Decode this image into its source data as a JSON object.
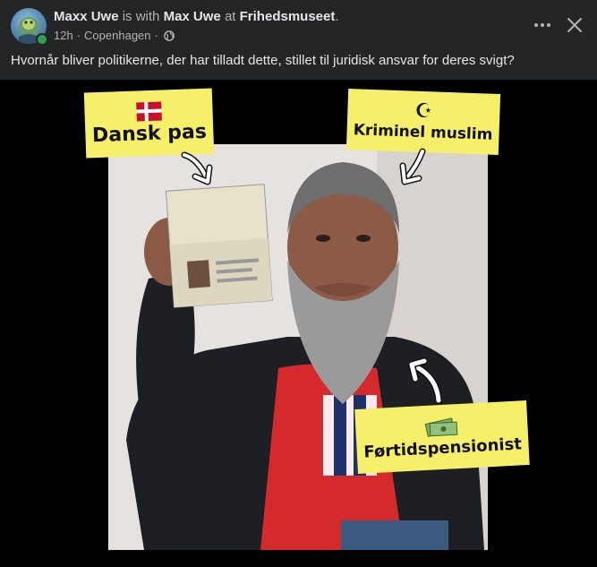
{
  "header": {
    "author": "Maxx Uwe",
    "with_text": "is with",
    "tagged": "Max Uwe",
    "at_text": "at",
    "place": "Frihedsmuseet",
    "period": ".",
    "time": "12h",
    "location": "Copenhagen",
    "separator": "·",
    "audience_icon": "globe-icon"
  },
  "actions": {
    "more_icon": "more-icon",
    "close_icon": "close-icon"
  },
  "post": {
    "text": "Hvornår bliver politikerne, der har tilladt dette, stillet til juridisk ansvar for deres svigt?"
  },
  "image": {
    "labels": {
      "passport": "Dansk pas",
      "criminal": "Kriminel muslim",
      "pension": "Førtidspensionist"
    },
    "symbols": {
      "crescent": "☪"
    }
  },
  "colors": {
    "background": "#242526",
    "text_primary": "#e4e6eb",
    "text_secondary": "#b0b3b8",
    "online": "#31a24c",
    "label_yellow": "#f5ef6a"
  }
}
